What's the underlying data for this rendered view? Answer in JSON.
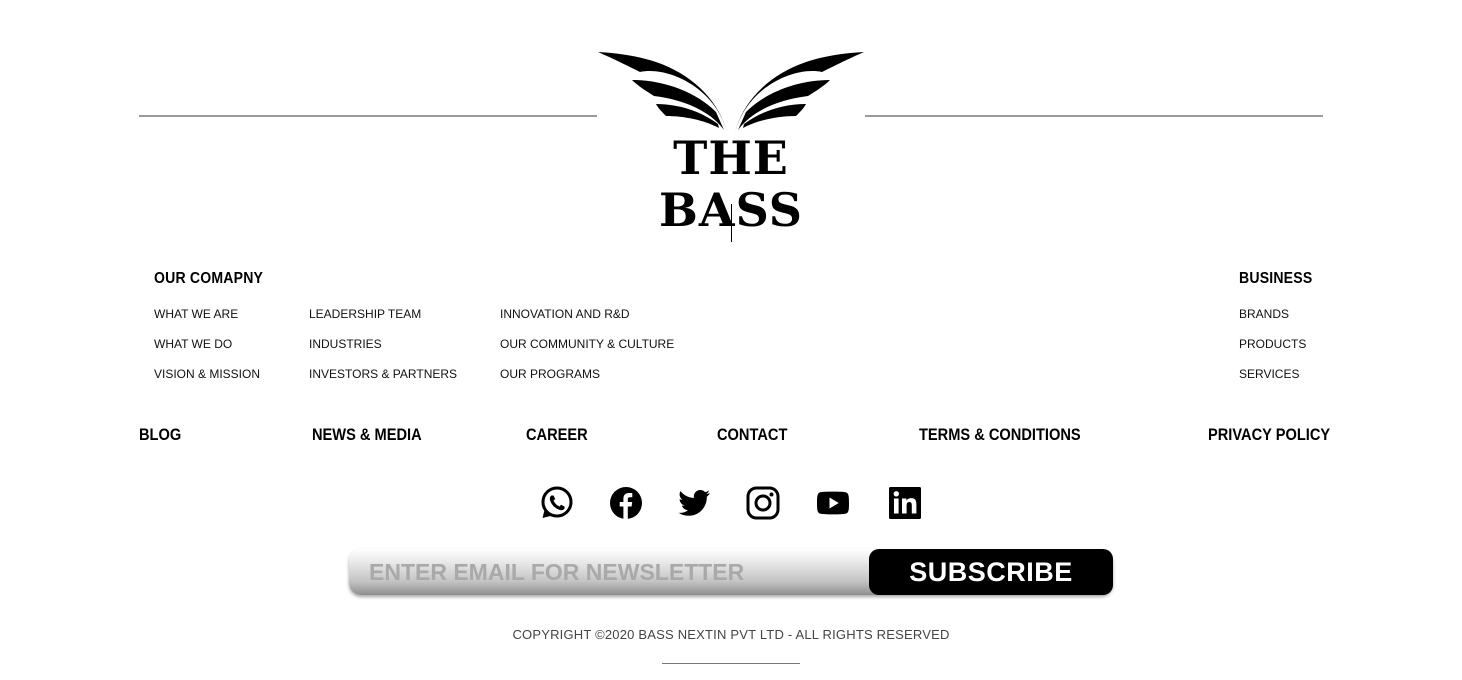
{
  "brand": {
    "name": "THE BASS"
  },
  "sections": {
    "company": {
      "heading": "OUR COMAPNY",
      "col1": [
        "WHAT WE ARE",
        "WHAT WE DO",
        "VISION & MISSION"
      ],
      "col2": [
        "LEADERSHIP TEAM",
        "INDUSTRIES",
        "INVESTORS & PARTNERS"
      ],
      "col3": [
        "INNOVATION AND R&D",
        "OUR COMMUNITY & CULTURE",
        "OUR PROGRAMS"
      ]
    },
    "business": {
      "heading": "BUSINESS",
      "links": [
        "BRANDS",
        "PRODUCTS",
        "SERVICES"
      ]
    }
  },
  "nav": [
    "BLOG",
    "NEWS & MEDIA",
    "CAREER",
    "CONTACT",
    "TERMS & CONDITIONS",
    "PRIVACY POLICY"
  ],
  "social": [
    "whatsapp-icon",
    "facebook-icon",
    "twitter-icon",
    "instagram-icon",
    "youtube-icon",
    "linkedin-icon"
  ],
  "newsletter": {
    "placeholder": "ENTER EMAIL FOR NEWSLETTER",
    "value": "",
    "button_label": "SUBSCRIBE"
  },
  "copyright": "COPYRIGHT ©2020 BASS NEXTIN PVT LTD - ALL RIGHTS RESERVED",
  "colors": {
    "text": "#000000",
    "divider": "#9a9a9a",
    "button_bg": "#000000",
    "button_text": "#ffffff"
  }
}
